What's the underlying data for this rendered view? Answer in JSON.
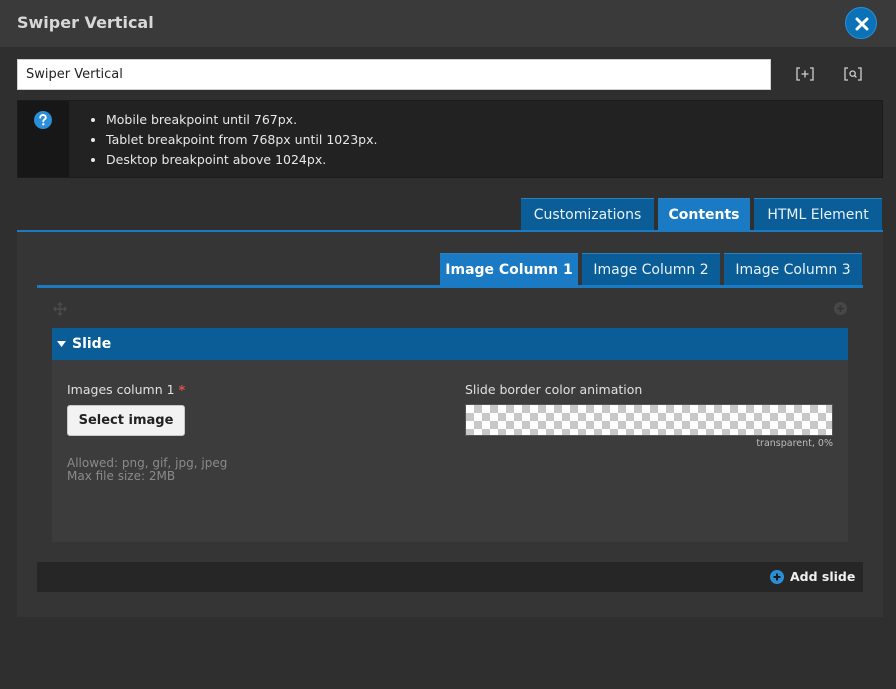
{
  "window": {
    "title": "Swiper Vertical"
  },
  "name_field": {
    "value": "Swiper Vertical"
  },
  "toolbar": {
    "expand_label": "[+]",
    "search_label": "[Q]"
  },
  "info": {
    "breakpoints": [
      "Mobile breakpoint until 767px.",
      "Tablet breakpoint from 768px until 1023px.",
      "Desktop breakpoint above 1024px."
    ]
  },
  "main_tabs": [
    {
      "label": "Customizations",
      "active": false
    },
    {
      "label": "Contents",
      "active": true
    },
    {
      "label": "HTML Element",
      "active": false
    }
  ],
  "column_tabs": [
    {
      "label": "Image Column 1",
      "active": true
    },
    {
      "label": "Image Column 2",
      "active": false
    },
    {
      "label": "Image Column 3",
      "active": false
    }
  ],
  "slide": {
    "title": "Slide",
    "images_label": "Images column 1",
    "required_mark": "*",
    "select_image_label": "Select image",
    "allowed_text": "Allowed: png, gif, jpg, jpeg",
    "max_size_text": "Max file size: 2MB",
    "border_color_label": "Slide border color animation",
    "border_color_value": "transparent, 0%"
  },
  "footer": {
    "add_slide_label": "Add slide"
  },
  "colors": {
    "accent": "#0b5d97",
    "accent_active": "#1a7ac4",
    "background": "#2f2f2f"
  },
  "icons": [
    "close-icon",
    "expand-icon",
    "search-icon",
    "help-icon",
    "drag-handle-icon",
    "caret-down-icon",
    "add-circle-icon"
  ]
}
